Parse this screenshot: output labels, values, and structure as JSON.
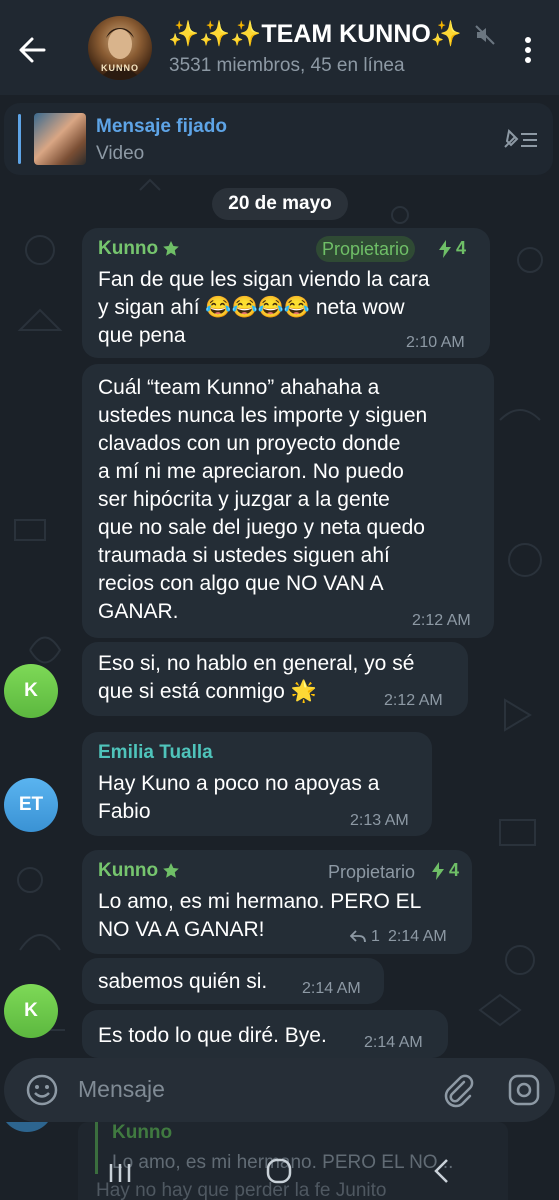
{
  "header": {
    "title": "✨✨✨TEAM KUNNO✨",
    "subtitle": "3531 miembros, 45 en línea",
    "avatar_text": "KUNNO"
  },
  "pinned": {
    "title": "Mensaje fijado",
    "subtitle": "Video"
  },
  "date_separator": "20 de mayo",
  "messages": [
    {
      "sender": "Kunno",
      "role": "Propietario",
      "boosts": "4",
      "lines": [
        "Fan de que les sigan viendo la cara",
        "y sigan ahí 😂😂😂😂 neta wow",
        "que pena"
      ],
      "time": "2:10 AM"
    },
    {
      "lines": [
        "Cuál “team Kunno” ahahaha a",
        "ustedes nunca les importe y siguen",
        "clavados con un proyecto donde",
        "a mí ni me apreciaron. No puedo",
        "ser hipócrita y juzgar a la gente",
        "que no sale del juego y neta quedo",
        "traumada si ustedes siguen ahí",
        "recios con algo que NO VAN A",
        "GANAR."
      ],
      "time": "2:12 AM"
    },
    {
      "lines": [
        "Eso si, no hablo en general, yo sé",
        "que si está conmigo 🌟"
      ],
      "time": "2:12 AM",
      "avatar": "K"
    },
    {
      "sender": "Emilia Tualla",
      "lines": [
        "Hay Kuno a poco no apoyas a",
        "Fabio"
      ],
      "time": "2:13 AM",
      "avatar": "ET"
    },
    {
      "sender": "Kunno",
      "role": "Propietario",
      "boosts": "4",
      "lines": [
        "Lo amo, es mi hermano. PERO EL",
        "NO VA A GANAR!"
      ],
      "replies": "1",
      "time": "2:14 AM"
    },
    {
      "lines": [
        "sabemos quién si."
      ],
      "time": "2:14 AM"
    },
    {
      "lines": [
        "Es todo lo que diré. Bye."
      ],
      "time": "2:14 AM",
      "avatar": "K"
    }
  ],
  "input": {
    "placeholder": "Mensaje"
  },
  "reply_preview": {
    "name": "Kunno",
    "text": "Lo amo, es mi hermano. PERO EL NO...",
    "text2": "Hay no hay que perder la fe Junito"
  },
  "colors": {
    "background": "#1b2128",
    "bubble": "#242d36",
    "accent_blue": "#5ea4e6",
    "owner_green": "#76c56e",
    "teal_name": "#4fc4bb"
  }
}
